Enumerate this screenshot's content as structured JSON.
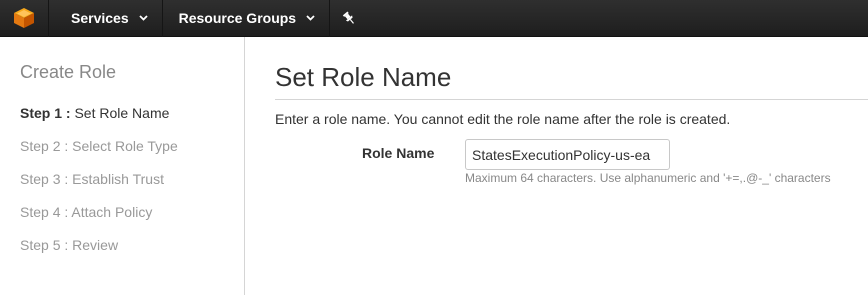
{
  "topbar": {
    "logo_icon": "aws-cube-icon",
    "services_label": "Services",
    "resource_groups_label": "Resource Groups",
    "pin_icon": "pin-icon",
    "brand_color": "#f29100"
  },
  "sidebar": {
    "title": "Create Role",
    "steps": [
      {
        "prefix": "Step 1 :",
        "label": "Set Role Name",
        "active": true
      },
      {
        "prefix": "Step 2 :",
        "label": "Select Role Type",
        "active": false
      },
      {
        "prefix": "Step 3 :",
        "label": "Establish Trust",
        "active": false
      },
      {
        "prefix": "Step 4 :",
        "label": "Attach Policy",
        "active": false
      },
      {
        "prefix": "Step 5 :",
        "label": "Review",
        "active": false
      }
    ]
  },
  "main": {
    "title": "Set Role Name",
    "description": "Enter a role name. You cannot edit the role name after the role is created.",
    "role_name": {
      "label": "Role Name",
      "value": "StatesExecutionPolicy-us-ea",
      "hint": "Maximum 64 characters. Use alphanumeric and '+=,.@-_' characters"
    }
  }
}
